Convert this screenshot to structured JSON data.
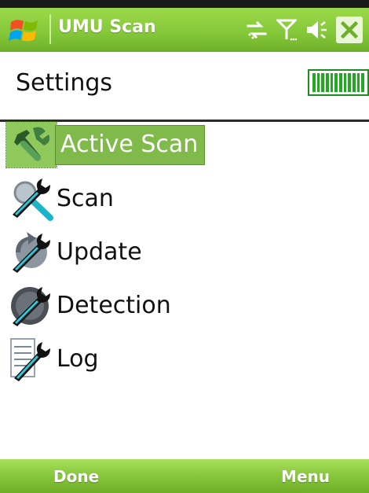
{
  "app": {
    "title": "UMU Scan"
  },
  "status": {
    "icons": [
      "connectivity-icon",
      "signal-icon",
      "volume-icon",
      "close-icon"
    ],
    "battery_level": 1.0
  },
  "header": {
    "title": "Settings"
  },
  "list": {
    "items": [
      {
        "label": "Active Scan",
        "icon": "active-scan-icon",
        "selected": true
      },
      {
        "label": "Scan",
        "icon": "scan-icon",
        "selected": false
      },
      {
        "label": "Update",
        "icon": "update-icon",
        "selected": false
      },
      {
        "label": "Detection",
        "icon": "detection-icon",
        "selected": false
      },
      {
        "label": "Log",
        "icon": "log-icon",
        "selected": false
      }
    ]
  },
  "softkeys": {
    "left": "Done",
    "right": "Menu"
  },
  "colors": {
    "accent_green": "#86c93a",
    "selection_green": "#7fba4a",
    "battery_green": "#22a822"
  }
}
